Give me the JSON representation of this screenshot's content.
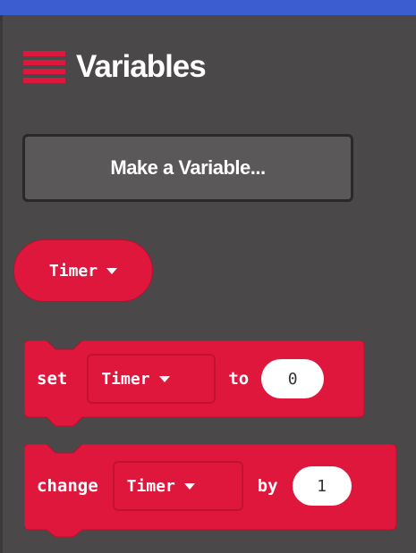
{
  "title": "Variables",
  "make_variable_label": "Make a Variable...",
  "reporter": {
    "variable": "Timer"
  },
  "set_block": {
    "keyword": "set",
    "variable": "Timer",
    "connector": "to",
    "value": "0"
  },
  "change_block": {
    "keyword": "change",
    "variable": "Timer",
    "connector": "by",
    "value": "1"
  },
  "colors": {
    "category": "#e0173d",
    "background": "#4a4848",
    "top_bar": "#3b5dd0"
  },
  "icons": {
    "category_icon": "hamburger-list-icon",
    "dropdown_icon": "caret-down-icon"
  }
}
